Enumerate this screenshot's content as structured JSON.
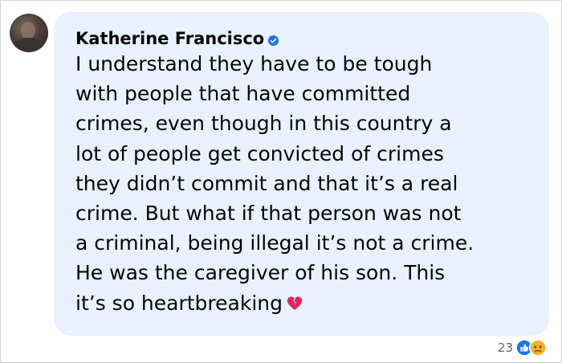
{
  "comment": {
    "author": "Katherine Francisco",
    "verified": true,
    "text": "I understand they have to be tough\nwith people that have committed\ncrimes, even though in this country a\nlot of people get convicted of crimes\nthey didn’t commit and that it’s a real\ncrime. But what if that person was not\na criminal, being illegal it’s not a crime.\nHe was the caregiver of his son. This\nit’s so heartbreaking",
    "emoji_icon": "broken-heart-icon"
  },
  "reactions": {
    "count": "23",
    "icons": [
      "like-icon",
      "sad-icon"
    ]
  },
  "colors": {
    "bubble": "#e8f1fd",
    "text": "#050505",
    "verified": "#1877f2",
    "broken_heart": "#e0245e",
    "like": "#1877f2",
    "sad": "#f7b125",
    "meta_text": "#65676b"
  }
}
